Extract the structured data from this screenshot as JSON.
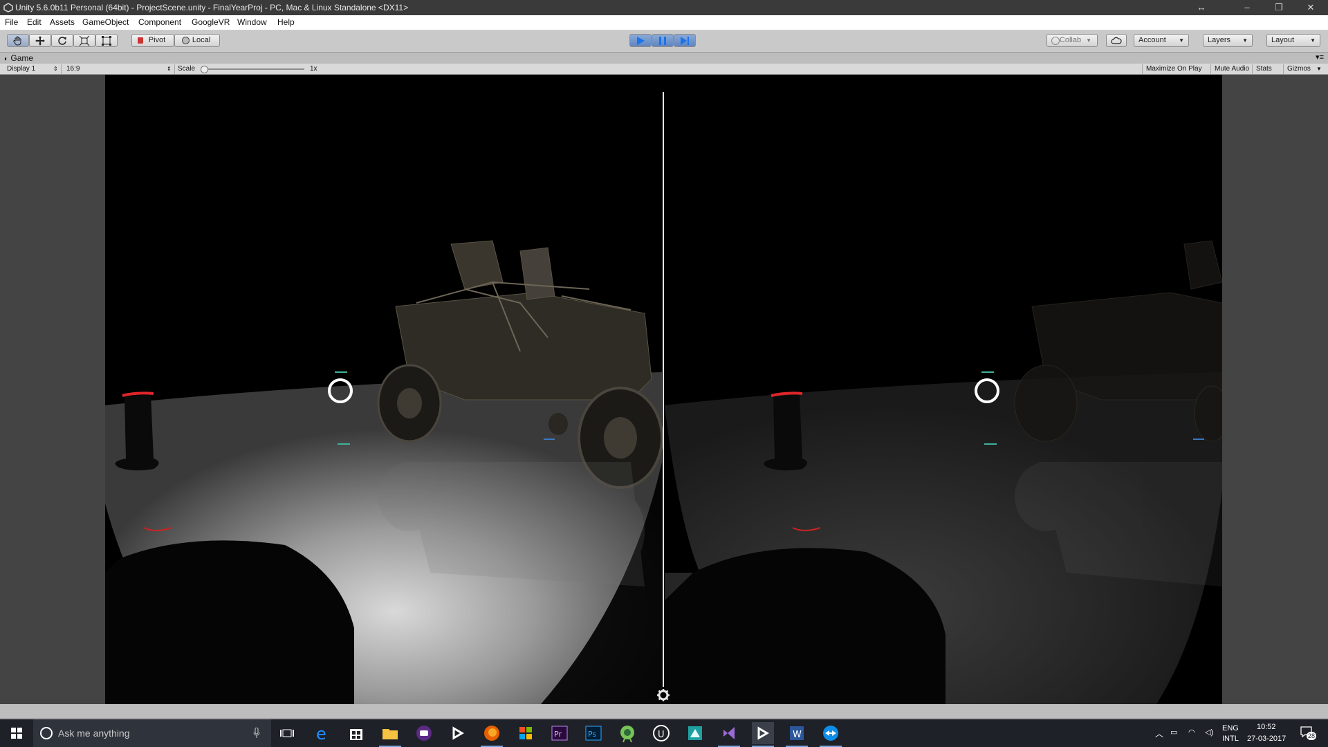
{
  "titlebar": {
    "title": "Unity 5.6.0b11 Personal (64bit) - ProjectScene.unity - FinalYearProj - PC, Mac & Linux Standalone <DX11>"
  },
  "menu": {
    "items": [
      "File",
      "Edit",
      "Assets",
      "GameObject",
      "Component",
      "GoogleVR",
      "Window",
      "Help"
    ]
  },
  "toolbar": {
    "pivot_label": "Pivot",
    "local_label": "Local",
    "collab_label": "Collab",
    "account_label": "Account",
    "layers_label": "Layers",
    "layout_label": "Layout"
  },
  "game_tab": {
    "title": "Game",
    "display": "Display 1",
    "aspect": "16:9",
    "scale_label": "Scale",
    "scale_value": "1x",
    "maximize_on_play": "Maximize On Play",
    "mute_audio": "Mute Audio",
    "stats": "Stats",
    "gizmos": "Gizmos"
  },
  "taskbar": {
    "search_placeholder": "Ask me anything",
    "apps": [
      "task-view",
      "edge",
      "store",
      "file-explorer",
      "app-purple",
      "unity-dark",
      "firefox",
      "app-tiles",
      "premiere",
      "photoshop",
      "android-studio",
      "unreal",
      "app-cyan",
      "visual-studio",
      "unity",
      "word",
      "teamviewer"
    ],
    "lang1": "ENG",
    "lang2": "INTL",
    "time": "10:52",
    "date": "27-03-2017",
    "notification_count": "28"
  },
  "colors": {
    "titlebar_bg": "#3a3a3a",
    "toolbar_bg": "#c9c9c9",
    "play_active": "#1a73e8",
    "taskbar_bg": "#1e2128"
  }
}
